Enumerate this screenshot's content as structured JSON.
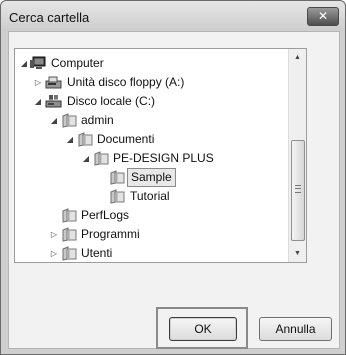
{
  "window": {
    "title": "Cerca cartella",
    "close_label": "✕"
  },
  "tree": {
    "items": [
      {
        "label": "Computer",
        "arrow": "◢",
        "icon": "computer-icon"
      },
      {
        "label": "Unità disco floppy (A:)",
        "arrow": "▷",
        "icon": "floppy-drive-icon"
      },
      {
        "label": "Disco locale (C:)",
        "arrow": "◢",
        "icon": "local-disk-icon"
      },
      {
        "label": "admin",
        "arrow": "◢",
        "icon": "folder-icon"
      },
      {
        "label": "Documenti",
        "arrow": "◢",
        "icon": "folder-icon"
      },
      {
        "label": "PE-DESIGN PLUS",
        "arrow": "◢",
        "icon": "folder-icon"
      },
      {
        "label": "Sample",
        "arrow": "",
        "icon": "folder-icon",
        "selected": true
      },
      {
        "label": "Tutorial",
        "arrow": "",
        "icon": "folder-icon"
      },
      {
        "label": "PerfLogs",
        "arrow": "",
        "icon": "folder-icon"
      },
      {
        "label": "Programmi",
        "arrow": "▷",
        "icon": "folder-icon"
      },
      {
        "label": "Utenti",
        "arrow": "▷",
        "icon": "folder-icon"
      }
    ]
  },
  "buttons": {
    "ok_label": "OK",
    "cancel_label": "Annulla"
  }
}
